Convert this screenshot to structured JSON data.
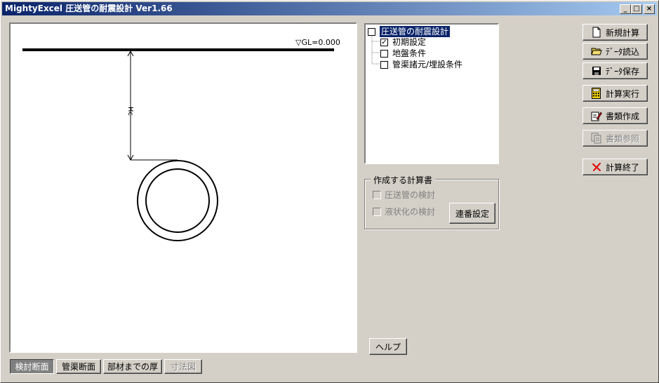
{
  "window": {
    "title": "MightyExcel 圧送管の耐震設計  Ver1.66",
    "controls": {
      "minimize": "_",
      "maximize": "□",
      "close": "×"
    }
  },
  "canvas": {
    "gl_label": "▽GL=0.000",
    "depth_label": "Hc"
  },
  "tree": {
    "root": {
      "label": "圧送管の耐震設計",
      "checked": false
    },
    "items": [
      {
        "label": "初期設定",
        "checked": true
      },
      {
        "label": "地盤条件",
        "checked": false
      },
      {
        "label": "管渠諸元/埋設条件",
        "checked": false
      }
    ]
  },
  "reports": {
    "title": "作成する計算書",
    "options": [
      {
        "label": "圧送管の検討"
      },
      {
        "label": "液状化の検討"
      }
    ],
    "numbering_button": "連番設定"
  },
  "buttons": {
    "new": "新規計算",
    "load": "ﾃﾞｰﾀ読込",
    "save": "ﾃﾞｰﾀ保存",
    "run": "計算実行",
    "make_docs": "書類作成",
    "view_docs": "書類参照",
    "exit": "計算終了",
    "help": "ヘルプ"
  },
  "view_tabs": [
    "検討断面",
    "管渠断面",
    "部材までの厚",
    "寸法図"
  ],
  "colors": {
    "titlebar_start": "#0a246a",
    "titlebar_end": "#a6caf0",
    "face": "#d4d0c8",
    "selection": "#0a246a"
  }
}
